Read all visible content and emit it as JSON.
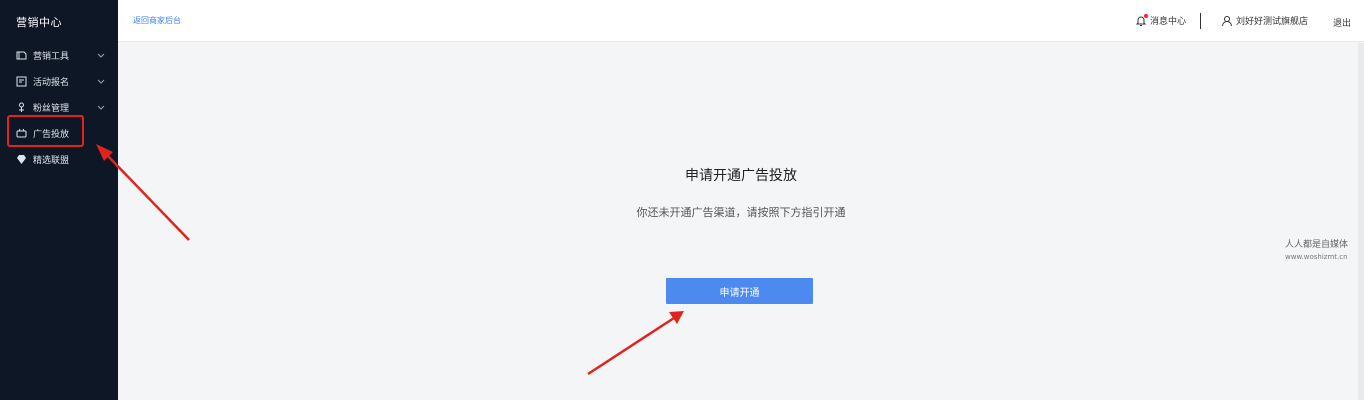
{
  "sidebar": {
    "brand": "营销中心",
    "items": [
      {
        "label": "营销工具",
        "icon": "ticket-icon",
        "has_chevron": true
      },
      {
        "label": "活动报名",
        "icon": "calendar-icon",
        "has_chevron": true
      },
      {
        "label": "粉丝管理",
        "icon": "fan-icon",
        "has_chevron": true
      },
      {
        "label": "广告投放",
        "icon": "ad-icon",
        "has_chevron": false
      },
      {
        "label": "精选联盟",
        "icon": "diamond-icon",
        "has_chevron": false
      }
    ]
  },
  "header": {
    "back_link": "返回商家后台",
    "messages": "消息中心",
    "user": "刘好好测试旗舰店",
    "logout": "退出"
  },
  "main": {
    "title": "申请开通广告投放",
    "subtitle": "你还未开通广告渠道，请按照下方指引开通",
    "apply_button": "申请开通"
  },
  "watermark": {
    "line1": "人人都是自媒体",
    "line2": "www.woshizmt.cn"
  },
  "colors": {
    "sidebar_bg": "#0e1726",
    "accent": "#4d8af0",
    "annotation": "#e0241d"
  }
}
